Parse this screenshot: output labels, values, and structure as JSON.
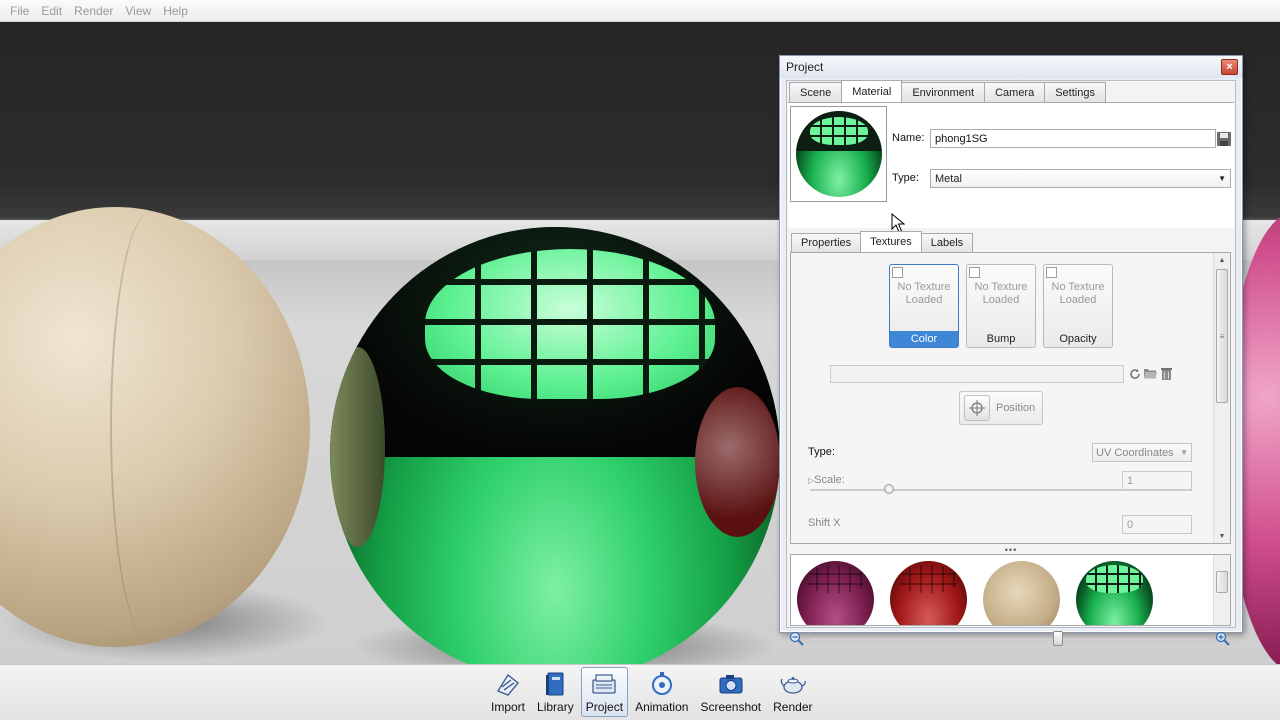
{
  "menu": [
    "File",
    "Edit",
    "Render",
    "View",
    "Help"
  ],
  "project": {
    "title": "Project",
    "close_glyph": "×",
    "tabs": [
      "Scene",
      "Material",
      "Environment",
      "Camera",
      "Settings"
    ],
    "active_tab": "Material",
    "name_label": "Name:",
    "name_value": "phong1SG",
    "type_label": "Type:",
    "type_value": "Metal",
    "subtabs": [
      "Properties",
      "Textures",
      "Labels"
    ],
    "active_subtab": "Textures",
    "texture_slots": [
      {
        "empty_text": "No Texture Loaded",
        "label": "Color",
        "selected": true
      },
      {
        "empty_text": "No Texture Loaded",
        "label": "Bump",
        "selected": false
      },
      {
        "empty_text": "No Texture Loaded",
        "label": "Opacity",
        "selected": false
      }
    ],
    "texture_path": "",
    "position_button": "Position",
    "mapping_type_label": "Type:",
    "mapping_type_value": "UV Coordinates",
    "scale_label": "Scale:",
    "scale_value": "1",
    "shift_x_label": "Shift X",
    "shift_x_value": "0",
    "splitter_glyph": "•••",
    "library_materials": [
      "purple",
      "red",
      "wood",
      "green"
    ]
  },
  "toolbar": {
    "items": [
      {
        "label": "Import",
        "icon": "import-icon",
        "active": false
      },
      {
        "label": "Library",
        "icon": "library-icon",
        "active": false
      },
      {
        "label": "Project",
        "icon": "project-icon",
        "active": true
      },
      {
        "label": "Animation",
        "icon": "animation-icon",
        "active": false
      },
      {
        "label": "Screenshot",
        "icon": "screenshot-icon",
        "active": false
      },
      {
        "label": "Render",
        "icon": "render-teapot-icon",
        "active": false
      }
    ]
  },
  "colors": {
    "accent": "#3d87d6",
    "close_button": "#c94630",
    "green_material": "#19b04f"
  }
}
